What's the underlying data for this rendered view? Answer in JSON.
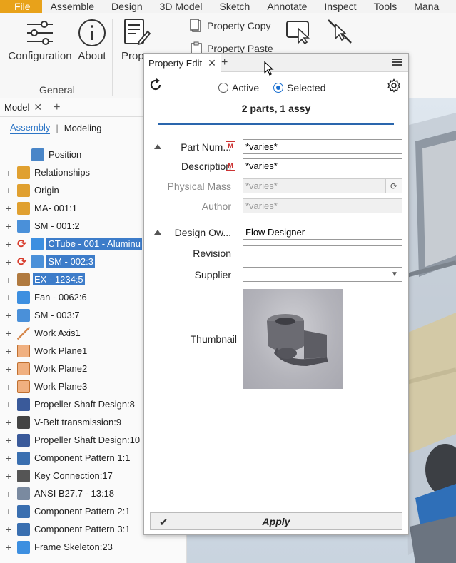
{
  "menubar": {
    "items": [
      "File",
      "Assemble",
      "Design",
      "3D Model",
      "Sketch",
      "Annotate",
      "Inspect",
      "Tools",
      "Mana"
    ]
  },
  "ribbon": {
    "configuration_label": "Configuration",
    "about_label": "About",
    "property_label": "Prope",
    "property_copy_label": "Property Copy",
    "property_paste_label": "Property Paste",
    "group_label": "General"
  },
  "browser": {
    "tab_label": "Model",
    "mode_assembly": "Assembly",
    "mode_modeling": "Modeling",
    "items": [
      {
        "label": "Position",
        "icon": "position-icon",
        "expandable": false,
        "selected": false,
        "indent": 1
      },
      {
        "label": "Relationships",
        "icon": "relationships-icon",
        "expandable": true,
        "selected": false,
        "indent": 0
      },
      {
        "label": "Origin",
        "icon": "origin-icon",
        "expandable": true,
        "selected": false,
        "indent": 0
      },
      {
        "label": "MA- 001:1",
        "icon": "assembly-icon",
        "expandable": true,
        "selected": false,
        "indent": 0
      },
      {
        "label": "SM - 001:2",
        "icon": "sheetmetal-icon",
        "expandable": true,
        "selected": false,
        "indent": 0
      },
      {
        "label": "CTube - 001 - Aluminu",
        "icon": "part-icon",
        "expandable": true,
        "selected": true,
        "indent": 0,
        "refresh": true
      },
      {
        "label": "SM - 002:3",
        "icon": "sheetmetal-icon",
        "expandable": true,
        "selected": true,
        "indent": 0,
        "refresh": true
      },
      {
        "label": "EX - 1234:5",
        "icon": "extrusion-icon",
        "expandable": true,
        "selected": true,
        "indent": 0
      },
      {
        "label": "Fan - 0062:6",
        "icon": "part-icon",
        "expandable": true,
        "selected": false,
        "indent": 0
      },
      {
        "label": "SM - 003:7",
        "icon": "sheetmetal-icon",
        "expandable": true,
        "selected": false,
        "indent": 0
      },
      {
        "label": "Work Axis1",
        "icon": "work-axis-icon",
        "expandable": true,
        "selected": false,
        "indent": 0
      },
      {
        "label": "Work Plane1",
        "icon": "work-plane-icon",
        "expandable": true,
        "selected": false,
        "indent": 0
      },
      {
        "label": "Work Plane2",
        "icon": "work-plane-icon",
        "expandable": true,
        "selected": false,
        "indent": 0
      },
      {
        "label": "Work Plane3",
        "icon": "work-plane-icon",
        "expandable": true,
        "selected": false,
        "indent": 0
      },
      {
        "label": "Propeller Shaft Design:8",
        "icon": "shaft-icon",
        "expandable": true,
        "selected": false,
        "indent": 0
      },
      {
        "label": "V-Belt transmission:9",
        "icon": "vbelt-icon",
        "expandable": true,
        "selected": false,
        "indent": 0
      },
      {
        "label": "Propeller Shaft Design:10",
        "icon": "shaft-icon",
        "expandable": true,
        "selected": false,
        "indent": 0
      },
      {
        "label": "Component Pattern 1:1",
        "icon": "pattern-icon",
        "expandable": true,
        "selected": false,
        "indent": 0
      },
      {
        "label": "Key Connection:17",
        "icon": "key-connection-icon",
        "expandable": true,
        "selected": false,
        "indent": 0
      },
      {
        "label": "ANSI B27.7 - 13:18",
        "icon": "ansi-part-icon",
        "expandable": true,
        "selected": false,
        "indent": 0
      },
      {
        "label": "Component Pattern 2:1",
        "icon": "pattern-icon",
        "expandable": true,
        "selected": false,
        "indent": 0
      },
      {
        "label": "Component Pattern 3:1",
        "icon": "pattern-icon",
        "expandable": true,
        "selected": false,
        "indent": 0
      },
      {
        "label": "Frame Skeleton:23",
        "icon": "part-icon",
        "expandable": true,
        "selected": false,
        "indent": 0
      }
    ]
  },
  "panel": {
    "tab_label": "Property Edit",
    "scope_active": "Active",
    "scope_selected": "Selected",
    "selected_scope": "Selected",
    "count_text": "2 parts, 1 assy",
    "properties": {
      "part_number": {
        "label": "Part Num...",
        "value": "*varies*"
      },
      "description": {
        "label": "Description",
        "value": "*varies*"
      },
      "physical_mass": {
        "label": "Physical Mass",
        "value": "*varies*"
      },
      "author": {
        "label": "Author",
        "value": "*varies*"
      },
      "design_owner": {
        "label": "Design Ow...",
        "value": "Flow Designer"
      },
      "revision": {
        "label": "Revision",
        "value": ""
      },
      "supplier": {
        "label": "Supplier",
        "value": ""
      },
      "thumbnail": {
        "label": "Thumbnail"
      }
    },
    "apply_label": "Apply"
  },
  "colors": {
    "accent": "#2c75c6",
    "file_menu": "#e8a21a",
    "selection": "#3d7cc9"
  }
}
